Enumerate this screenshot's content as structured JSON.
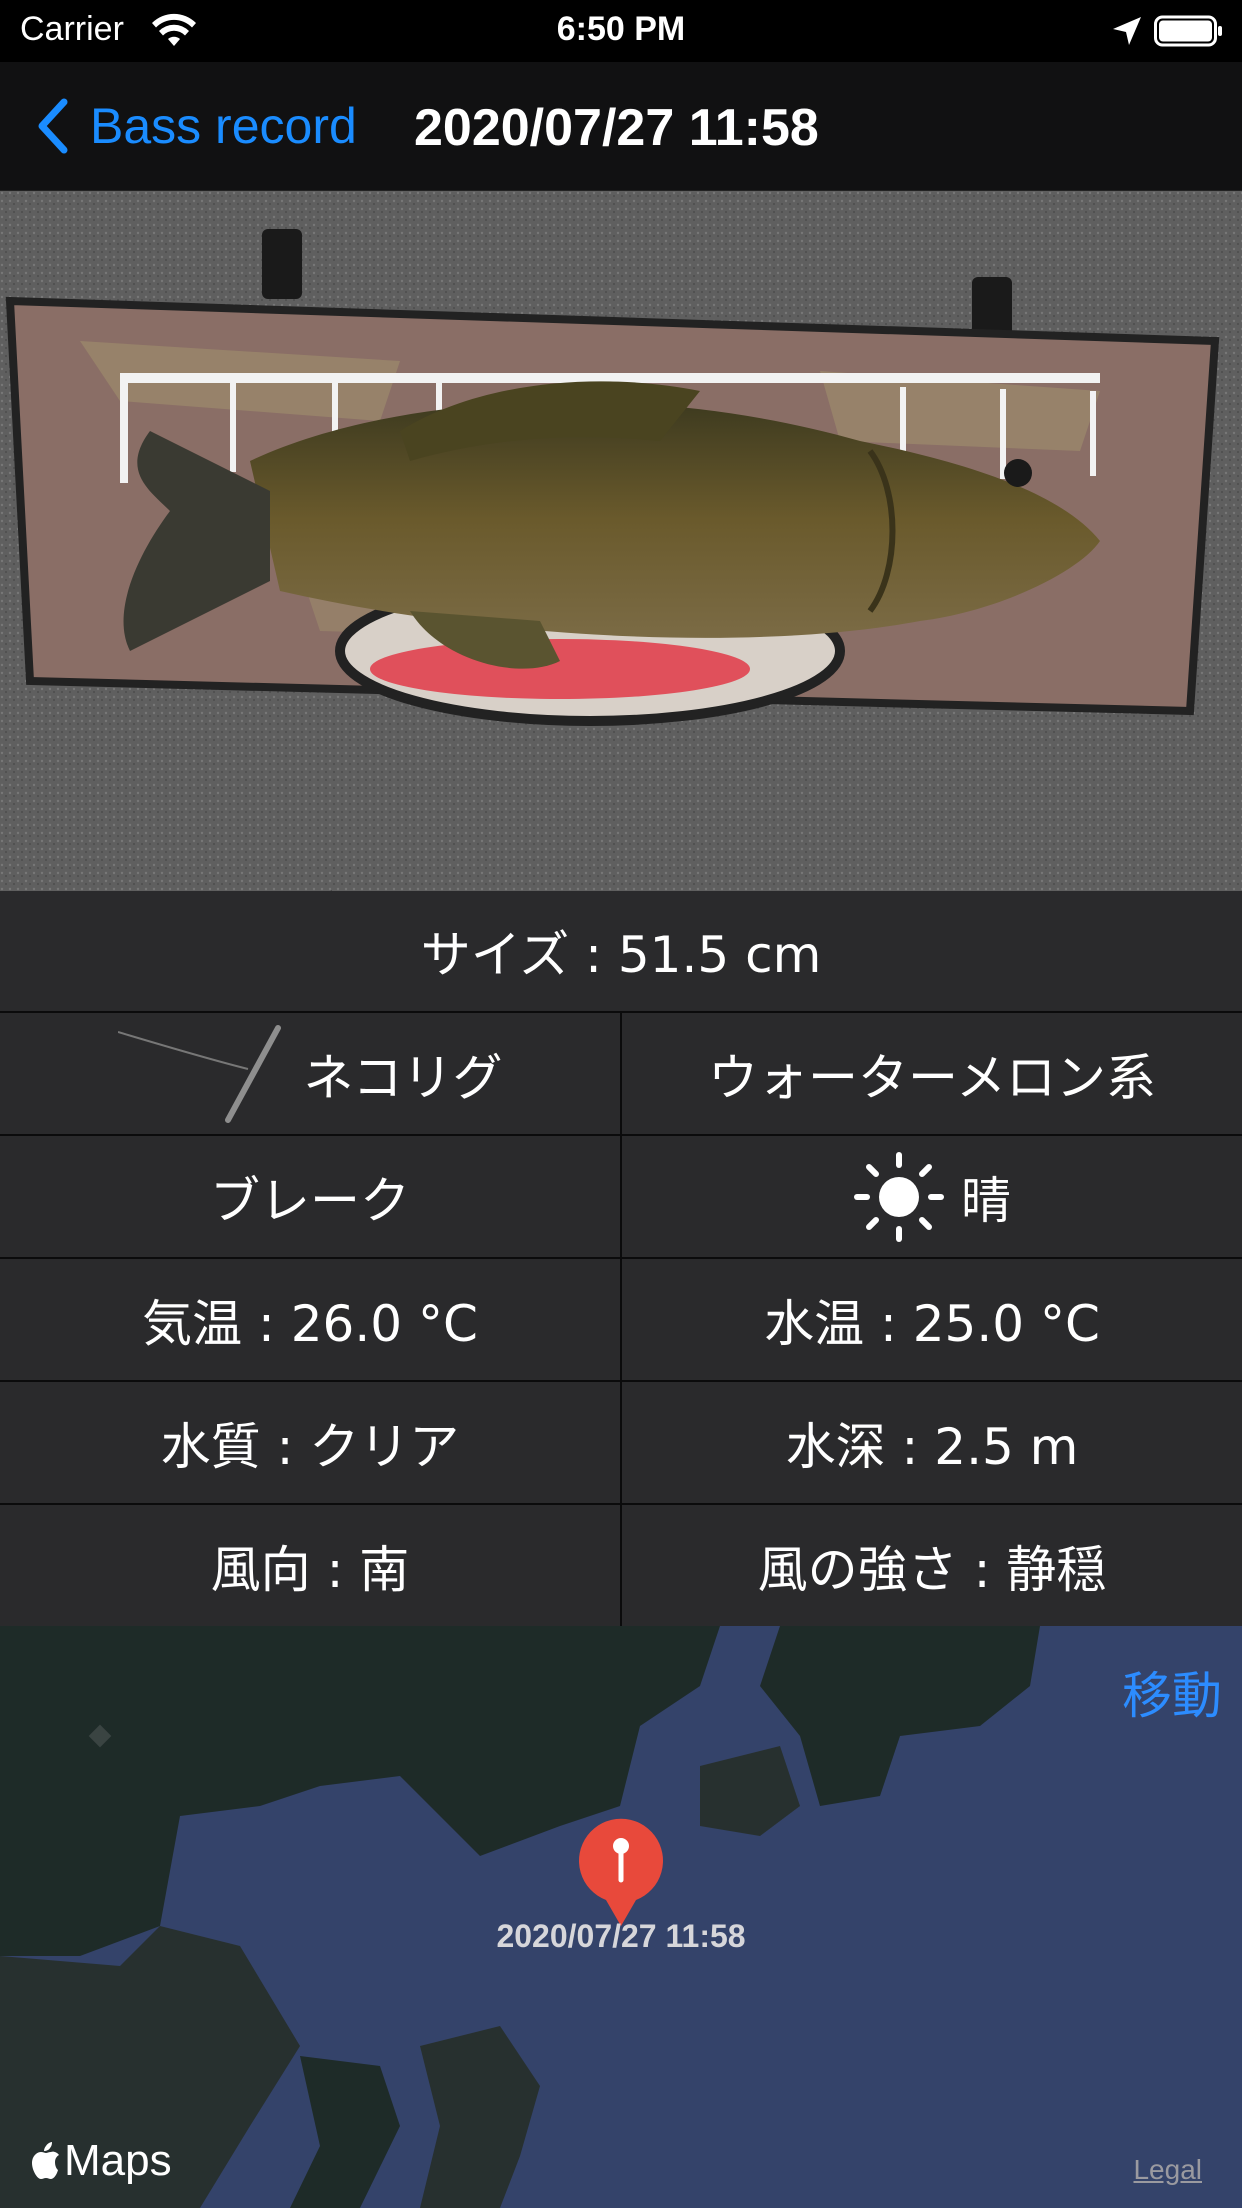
{
  "status_bar": {
    "carrier": "Carrier",
    "time": "6:50 PM"
  },
  "nav": {
    "back_label": "Bass record",
    "title": "2020/07/27 11:58"
  },
  "info": {
    "size": "サイズ : 51.5 cm",
    "rows": [
      {
        "left": "ネコリグ",
        "right": "ウォーターメロン系"
      },
      {
        "left": "ブレーク",
        "right": "晴"
      },
      {
        "left": "気温 : 26.0 °C",
        "right": "水温 : 25.0 °C"
      },
      {
        "left": "水質 : クリア",
        "right": "水深 : 2.5 m"
      },
      {
        "left": "風向 : 南",
        "right": "風の強さ : 静穏"
      }
    ]
  },
  "map": {
    "move_label": "移動",
    "pin_label": "2020/07/27 11:58",
    "logo_text": "Maps",
    "legal": "Legal"
  },
  "colors": {
    "accent": "#1a8cff",
    "pin": "#e8493b",
    "water": "#34436a",
    "land": "#1e2b28"
  }
}
